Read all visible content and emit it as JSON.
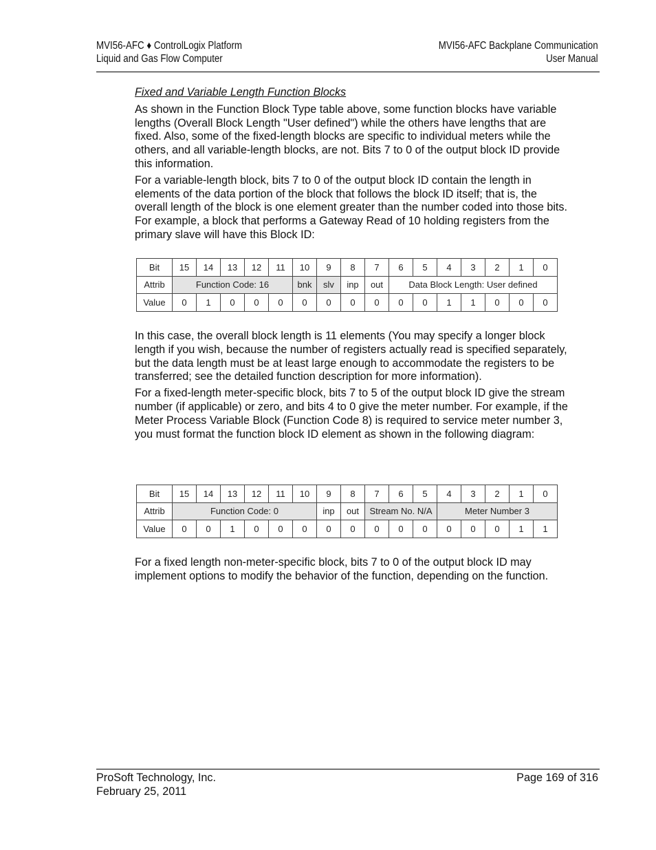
{
  "header": {
    "left_line1": "MVI56-AFC ♦ ControlLogix Platform",
    "left_line2": "Liquid and Gas Flow Computer",
    "right_line1": "MVI56-AFC Backplane Communication",
    "right_line2": "User Manual"
  },
  "section_title": "Fixed and Variable Length Function Blocks",
  "paragraphs": [
    "As shown in the Function Block Type table above, some function blocks have variable lengths (Overall Block Length \"User defined\") while the others have lengths that are fixed. Also, some of the fixed-length blocks are specific to individual meters while the others, and all variable-length blocks, are not. Bits 7 to 0 of the output block ID provide this information.",
    "For a variable-length block, bits 7 to 0 of the output block ID contain the length in elements of the data portion of the block that follows the block ID itself; that is, the overall length of the block is one element greater than the number coded into those bits. For example, a block that performs a Gateway Read of 10 holding registers from the primary slave will have this Block ID:",
    "In this case, the overall block length is 11 elements (You may specify a longer block length if you wish, because the number of registers actually read is specified separately, but the data length must be at least large enough to accommodate the registers to be transferred; see the detailed function description for more information).",
    "For a fixed-length meter-specific block, bits 7 to 5 of the output block ID give the stream number (if applicable) or zero, and bits 4 to 0 give the meter number. For example, if the Meter Process Variable Block (Function Code 8) is required to service meter number 3, you must format the function block ID element as shown in the following diagram:",
    "For a fixed length non-meter-specific block, bits 7 to 0 of the output block ID may implement options to modify the behavior of the function, depending on the function."
  ],
  "tables": [
    {
      "row_labels": {
        "bit": "Bit",
        "attrib": "Attrib",
        "value": "Value"
      },
      "bits": [
        "15",
        "14",
        "13",
        "12",
        "11",
        "10",
        "9",
        "8",
        "7",
        "6",
        "5",
        "4",
        "3",
        "2",
        "1",
        "0"
      ],
      "attribs": [
        {
          "label": "Function Code: 16",
          "span": 5,
          "shaded": true
        },
        {
          "label": "bnk",
          "span": 1,
          "shaded": true
        },
        {
          "label": "slv",
          "span": 1,
          "shaded": true
        },
        {
          "label": "inp",
          "span": 1,
          "shaded": false
        },
        {
          "label": "out",
          "span": 1,
          "shaded": false
        },
        {
          "label": "Data Block Length: User defined",
          "span": 8,
          "shaded": false
        }
      ],
      "values": [
        "0",
        "1",
        "0",
        "0",
        "0",
        "0",
        "0",
        "0",
        "0",
        "0",
        "0",
        "1",
        "1",
        "0",
        "0",
        "0"
      ]
    },
    {
      "row_labels": {
        "bit": "Bit",
        "attrib": "Attrib",
        "value": "Value"
      },
      "bits": [
        "15",
        "14",
        "13",
        "12",
        "11",
        "10",
        "9",
        "8",
        "7",
        "6",
        "5",
        "4",
        "3",
        "2",
        "1",
        "0"
      ],
      "attribs": [
        {
          "label": "Function Code: 0",
          "span": 6,
          "shaded": true
        },
        {
          "label": "inp",
          "span": 1,
          "shaded": false
        },
        {
          "label": "out",
          "span": 1,
          "shaded": false
        },
        {
          "label": "Stream No. N/A",
          "span": 3,
          "shaded": true
        },
        {
          "label": "Meter Number 3",
          "span": 5,
          "shaded": true
        }
      ],
      "values": [
        "0",
        "0",
        "1",
        "0",
        "0",
        "0",
        "0",
        "0",
        "0",
        "0",
        "0",
        "0",
        "0",
        "0",
        "1",
        "1"
      ]
    }
  ],
  "footer": {
    "company": "ProSoft Technology, Inc.",
    "date": "February 25, 2011",
    "page": "Page 169 of 316"
  }
}
